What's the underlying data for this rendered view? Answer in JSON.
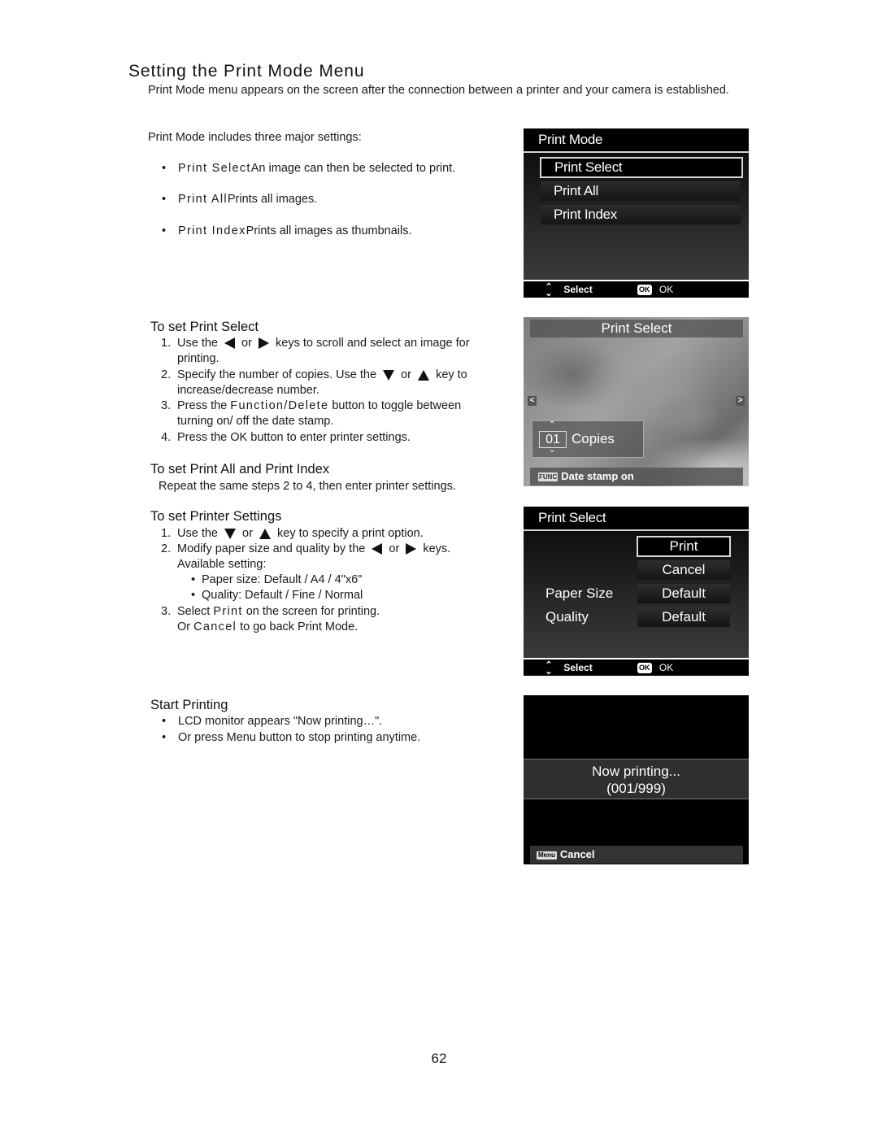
{
  "heading": "Setting the Print Mode Menu",
  "intro": "Print Mode menu appears on the screen after the connection between a printer and your camera is established.",
  "includes_text": "Print Mode includes three major settings:",
  "settings": [
    {
      "name": "Print Select",
      "desc": " An image can then be selected to print."
    },
    {
      "name": "Print All",
      "desc": " Prints all images."
    },
    {
      "name": "Print Index",
      "desc": " Prints all images as thumbnails."
    }
  ],
  "bullet": "•",
  "sections": {
    "print_select": {
      "title": "To set Print Select",
      "steps": {
        "s1_num": "1.",
        "s1_a": "Use the",
        "s1_or": "or",
        "s1_b": "keys to scroll and select an image for",
        "s1_c": "printing.",
        "s2_num": "2.",
        "s2_a": "Specify the number of copies. Use the",
        "s2_or": "or",
        "s2_b": "key to",
        "s2_c": "increase/decrease number.",
        "s3_num": "3.",
        "s3_a": "Press the ",
        "s3_key": "Function/Delete",
        "s3_b": " button to toggle between",
        "s3_c": "turning on/ off the date stamp.",
        "s4_num": "4.",
        "s4_a": "Press the OK button to enter printer settings."
      }
    },
    "print_all_index": {
      "title": "To set Print All and Print Index",
      "text": "Repeat the same steps 2 to 4, then enter printer settings."
    },
    "printer_settings": {
      "title": "To set Printer Settings",
      "s1_num": "1.",
      "s1_a": "Use the",
      "s1_or": "or",
      "s1_b": "key to specify a print option.",
      "s2_num": "2.",
      "s2_a": "Modify paper size and quality by the",
      "s2_or": "or",
      "s2_b": "keys.",
      "s2_c": "Available setting:",
      "sub1": "Paper size: Default / A4 / 4\"x6\"",
      "sub2": "Quality: Default / Fine / Normal",
      "s3_num": "3.",
      "s3_a": "Select ",
      "s3_key": "Print",
      "s3_b": " on the screen for printing.",
      "s3_c_a": "Or ",
      "s3_c_key": "Cancel",
      "s3_c_b": " to go back Print Mode."
    },
    "start_printing": {
      "title": "Start Printing",
      "b1": "LCD monitor appears \"Now printing…\".",
      "b2": "Or press Menu button to stop printing anytime."
    }
  },
  "screens": {
    "print_mode": {
      "title": "Print Mode",
      "items": [
        "Print Select",
        "Print All",
        "Print Index"
      ],
      "selected_index": 0,
      "footer_select": "Select",
      "footer_ok_badge": "OK",
      "footer_ok": "OK"
    },
    "print_select_photo": {
      "title": "Print Select",
      "copies_value": "01",
      "copies_label": "Copies",
      "func_badge": "FUNC",
      "date_stamp": "Date stamp on",
      "left_arrow": "<",
      "right_arrow": ">"
    },
    "printer_settings": {
      "title": "Print Select",
      "buttons": [
        "Print",
        "Cancel"
      ],
      "paper_size_label": "Paper Size",
      "paper_size_value": "Default",
      "quality_label": "Quality",
      "quality_value": "Default",
      "footer_select": "Select",
      "footer_ok_badge": "OK",
      "footer_ok": "OK"
    },
    "now_printing": {
      "line1": "Now printing...",
      "line2": "(001/999)",
      "menu_badge": "Menu",
      "cancel": "Cancel"
    }
  },
  "page_number": "62"
}
